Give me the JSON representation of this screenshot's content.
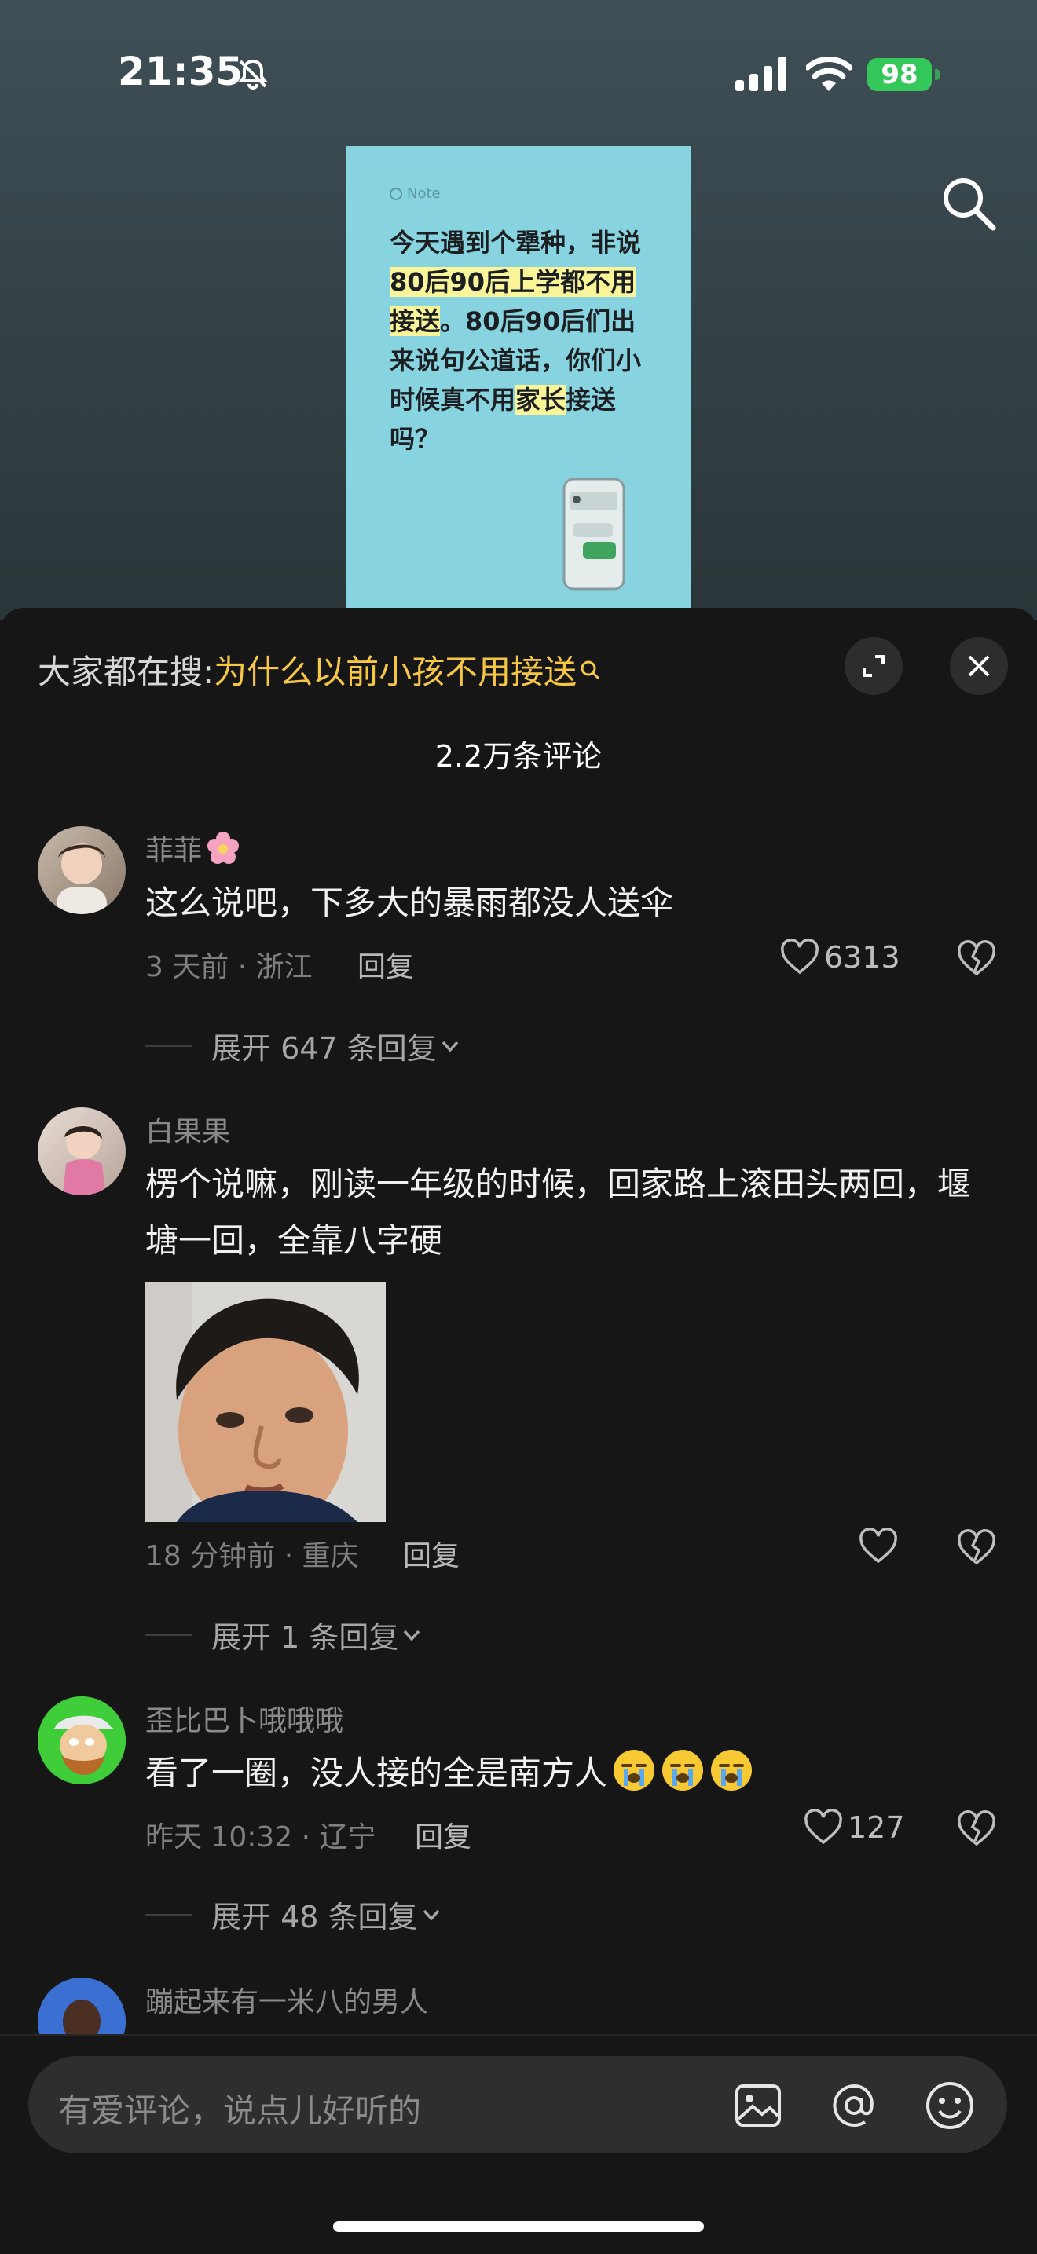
{
  "status_bar": {
    "time": "21:35",
    "battery": "98"
  },
  "note": {
    "tag": "Note",
    "segments": [
      {
        "text": "今天遇到个犟种，非说",
        "hl": false
      },
      {
        "text": "80后90后上学都不用接送",
        "hl": true
      },
      {
        "text": "。80后90后们出来说句公道话，你们小时候真不用",
        "hl": false
      },
      {
        "text": "家长",
        "hl": true
      },
      {
        "text": "接送吗？",
        "hl": false
      }
    ]
  },
  "sheet": {
    "hot_search_prefix": "大家都在搜:",
    "hot_search_term": "为什么以前小孩不用接送",
    "comment_count": "2.2万条评论"
  },
  "comments": [
    {
      "user": "菲菲",
      "text": "这么说吧，下多大的暴雨都没人送伞",
      "meta": "3 天前 · 浙江",
      "reply": "回复",
      "likes": "6313",
      "expand": "展开 647 条回复"
    },
    {
      "user": "白果果",
      "text": "楞个说嘛，刚读一年级的时候，回家路上滚田头两回，堰塘一回，全靠八字硬",
      "meta": "18 分钟前 · 重庆",
      "reply": "回复",
      "likes": "",
      "expand": "展开 1 条回复"
    },
    {
      "user": "歪比巴卜哦哦哦",
      "text": "看了一圈，没人接的全是南方人",
      "meta": "昨天 10:32 · 辽宁",
      "reply": "回复",
      "likes": "127",
      "expand": "展开 48 条回复"
    },
    {
      "user": "蹦起来有一米八的男人"
    }
  ],
  "input": {
    "placeholder": "有爱评论，说点儿好听的"
  },
  "colors": {
    "accent_yellow": "#f7c744",
    "background": "#161616",
    "battery": "#34c759"
  }
}
